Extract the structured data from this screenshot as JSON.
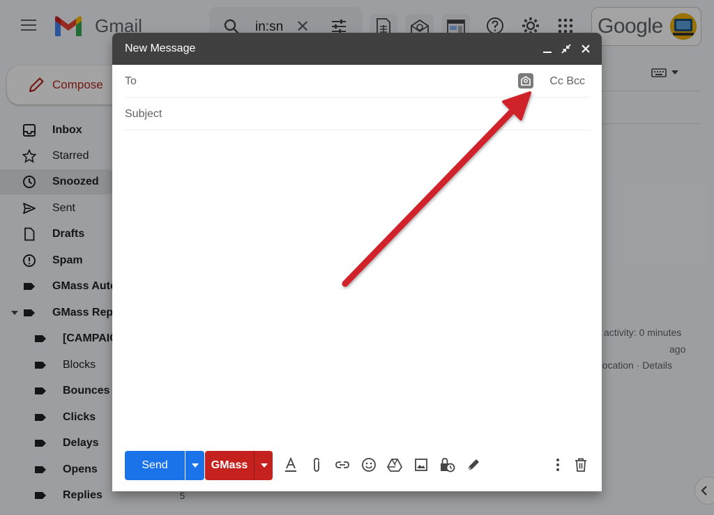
{
  "header": {
    "brand": "Gmail",
    "search_query": "in:sn",
    "account_label": "Google"
  },
  "sidebar": {
    "compose_label": "Compose",
    "items": [
      {
        "label": "Inbox"
      },
      {
        "label": "Starred"
      },
      {
        "label": "Snoozed"
      },
      {
        "label": "Sent"
      },
      {
        "label": "Drafts"
      },
      {
        "label": "Spam"
      },
      {
        "label": "GMass Auto"
      },
      {
        "label": "GMass Rep"
      },
      {
        "label": "[CAMPAIG"
      },
      {
        "label": "Blocks"
      },
      {
        "label": "Bounces"
      },
      {
        "label": "Clicks"
      },
      {
        "label": "Delays"
      },
      {
        "label": "Opens"
      },
      {
        "label": "Replies"
      }
    ],
    "replies_count": "5"
  },
  "activity": {
    "line1": "activity: 0 minutes",
    "line2": "ago",
    "line3": "r location · Details"
  },
  "compose": {
    "title": "New Message",
    "to_label": "To",
    "cc_bcc_label": "Cc Bcc",
    "subject_placeholder": "Subject",
    "send_label": "Send",
    "gmass_label": "GMass"
  },
  "colors": {
    "send_blue": "#1a73e8",
    "gmass_red": "#c5221f",
    "annotation_arrow": "#d0222a",
    "compose_header": "#404040"
  }
}
